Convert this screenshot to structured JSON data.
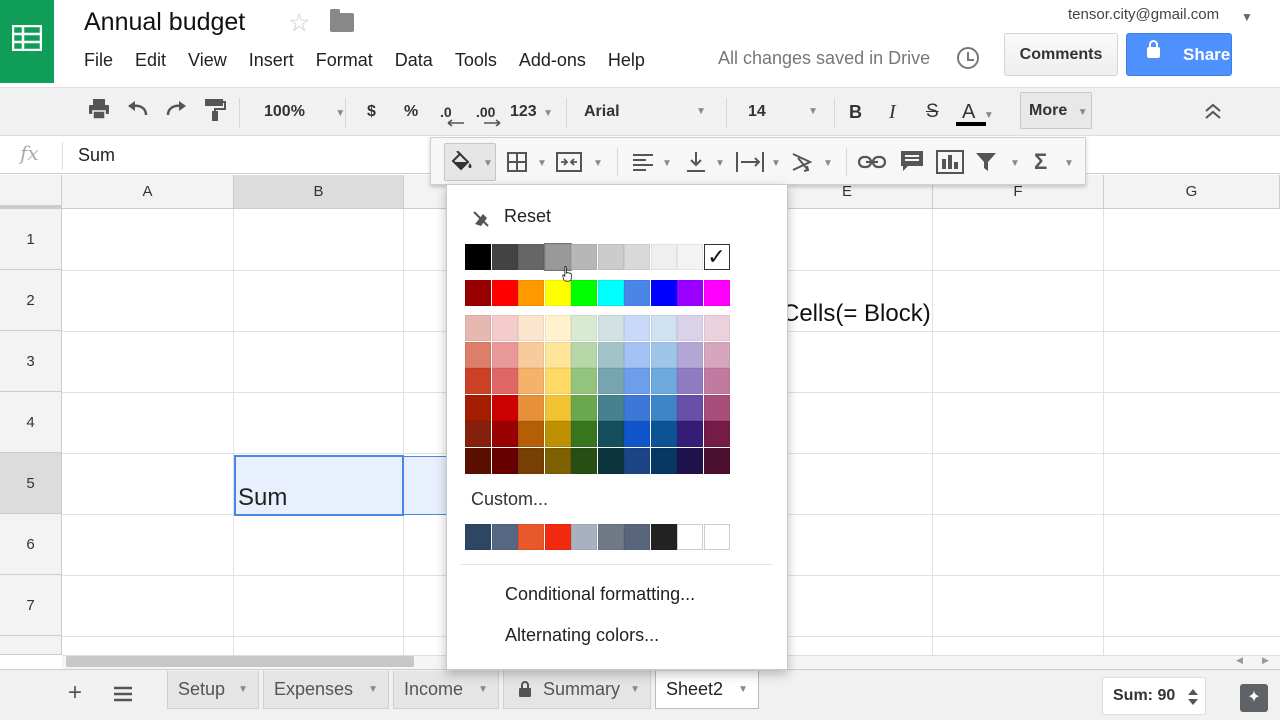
{
  "app": {
    "doc_title": "Annual budget",
    "account": "tensor.city@gmail.com",
    "save_status": "All changes saved in Drive",
    "comments_label": "Comments",
    "share_label": "Share"
  },
  "menu": [
    "File",
    "Edit",
    "View",
    "Insert",
    "Format",
    "Data",
    "Tools",
    "Add-ons",
    "Help"
  ],
  "toolbar": {
    "zoom": "100%",
    "currency": "$",
    "percent": "%",
    "dec_decrease": ".0",
    "dec_increase": ".00",
    "more_formats": "123",
    "font": "Arial",
    "font_size": "14",
    "bold": "B",
    "italic": "I",
    "strikethrough": "S",
    "text_color": "A",
    "more_label": "More"
  },
  "formula_bar": {
    "fx": "fx",
    "value": "Sum"
  },
  "grid": {
    "columns": [
      "A",
      "B",
      "E",
      "F",
      "G"
    ],
    "rows": [
      "1",
      "2",
      "3",
      "4",
      "5",
      "6",
      "7"
    ],
    "selected_row": "5",
    "cells": {
      "b5": "Sum",
      "e2_partial": "Cells(= Block)"
    }
  },
  "color_menu": {
    "reset_label": "Reset",
    "custom_label": "Custom...",
    "conditional_label": "Conditional formatting...",
    "alternating_label": "Alternating colors...",
    "checked_mark": "✓",
    "grays": [
      "#000000",
      "#434343",
      "#666666",
      "#999999",
      "#b7b7b7",
      "#cccccc",
      "#d9d9d9",
      "#efefef",
      "#f3f3f3",
      "#ffffff"
    ],
    "brights": [
      "#980000",
      "#ff0000",
      "#ff9900",
      "#ffff00",
      "#00ff00",
      "#00ffff",
      "#4a86e8",
      "#0000ff",
      "#9900ff",
      "#ff00ff"
    ],
    "shades": [
      [
        "#e6b8af",
        "#f4cccc",
        "#fce5cd",
        "#fff2cc",
        "#d9ead3",
        "#d0e0e3",
        "#c9daf8",
        "#cfe2f3",
        "#d9d2e9",
        "#ead1dc"
      ],
      [
        "#dd7e6b",
        "#ea9999",
        "#f9cb9c",
        "#ffe599",
        "#b6d7a8",
        "#a2c4c9",
        "#a4c2f4",
        "#9fc5e8",
        "#b4a7d6",
        "#d5a6bd"
      ],
      [
        "#cc4125",
        "#e06666",
        "#f6b26b",
        "#ffd966",
        "#93c47d",
        "#76a5af",
        "#6d9eeb",
        "#6fa8dc",
        "#8e7cc3",
        "#c27ba0"
      ],
      [
        "#a61c00",
        "#cc0000",
        "#e69138",
        "#f1c232",
        "#6aa84f",
        "#45818e",
        "#3c78d8",
        "#3d85c6",
        "#674ea7",
        "#a64d79"
      ],
      [
        "#85200c",
        "#990000",
        "#b45f06",
        "#bf9000",
        "#38761d",
        "#134f5c",
        "#1155cc",
        "#0b5394",
        "#351c75",
        "#741b47"
      ],
      [
        "#5b0f00",
        "#660000",
        "#783f04",
        "#7f6000",
        "#274e13",
        "#0c343d",
        "#1c4587",
        "#073763",
        "#20124d",
        "#4c1130"
      ]
    ],
    "custom_colors": [
      "#2e4663",
      "#566781",
      "#e8582a",
      "#f22a0f",
      "#a8b1bf",
      "#707a87",
      "#58657a",
      "#222222",
      "#ffffff",
      "#ffffff"
    ]
  },
  "sheet_tabs": [
    "Setup",
    "Expenses",
    "Income",
    "Summary",
    "Sheet2"
  ],
  "status": {
    "sum": "Sum: 90"
  }
}
